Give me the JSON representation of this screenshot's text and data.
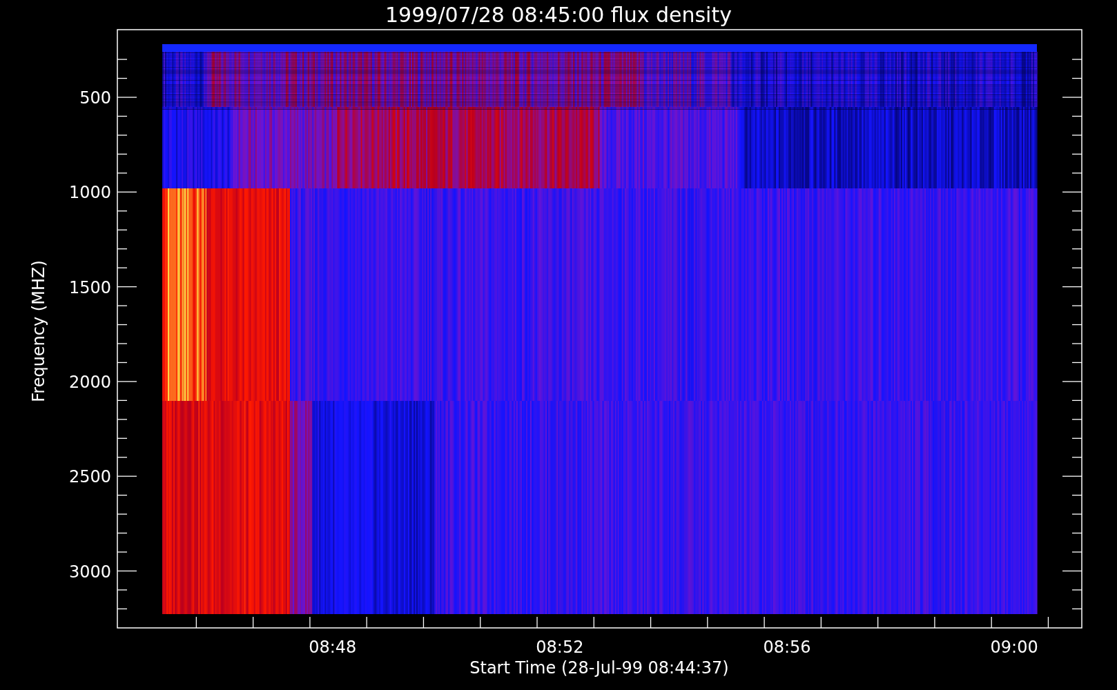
{
  "title": "1999/07/28 08:45:00 flux density",
  "y_axis": {
    "label": "Frequency (MHZ)",
    "ticks": [
      "500",
      "1000",
      "1500",
      "2000",
      "2500",
      "3000"
    ]
  },
  "x_axis": {
    "label": "Start Time (28-Jul-99 08:44:37)",
    "ticks": [
      "08:48",
      "08:52",
      "08:56",
      "09:00"
    ]
  }
}
